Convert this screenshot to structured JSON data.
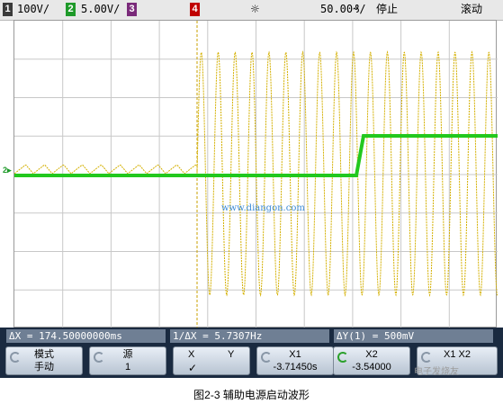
{
  "top_bar": {
    "ch1": {
      "number": "1",
      "scale": "100V/",
      "color": "#3a3a3a"
    },
    "ch2": {
      "number": "2",
      "scale": "5.00V/",
      "color": "#1f9a2a"
    },
    "ch3": {
      "number": "3",
      "color": "#7a2a7a"
    },
    "ch4": {
      "number": "4",
      "color": "#c00000"
    },
    "trigger_symbol": "☼",
    "timebase": "50.00₰/",
    "run_state": "停止",
    "mode": "滚动"
  },
  "waveforms": {
    "ch1_color": "#d4b000",
    "ch2_color": "#22c81e",
    "grid_color": "#c8c8c8"
  },
  "plot_watermark": "www.diangon.com",
  "readouts": {
    "delta_x": "ΔX = 174.50000000ms",
    "inv_delta_x": "1/ΔX = 5.7307Hz",
    "delta_y": "ΔY(1) = 500mV"
  },
  "softkeys": {
    "mode": {
      "line1": "模式",
      "line2": "手动"
    },
    "source": {
      "line1": "源",
      "line2": "1"
    },
    "xy": {
      "line1_left": "X",
      "line1_right": "Y",
      "line2_left": "✓"
    },
    "x1": {
      "line1": "X1",
      "line2": "-3.71450s"
    },
    "x2": {
      "line1": "X2",
      "line2": "-3.54000"
    },
    "x1x2": {
      "line1": "X1 X2"
    }
  },
  "corner_watermark": "电子发烧友",
  "caption": "图2-3 辅助电源启动波形"
}
